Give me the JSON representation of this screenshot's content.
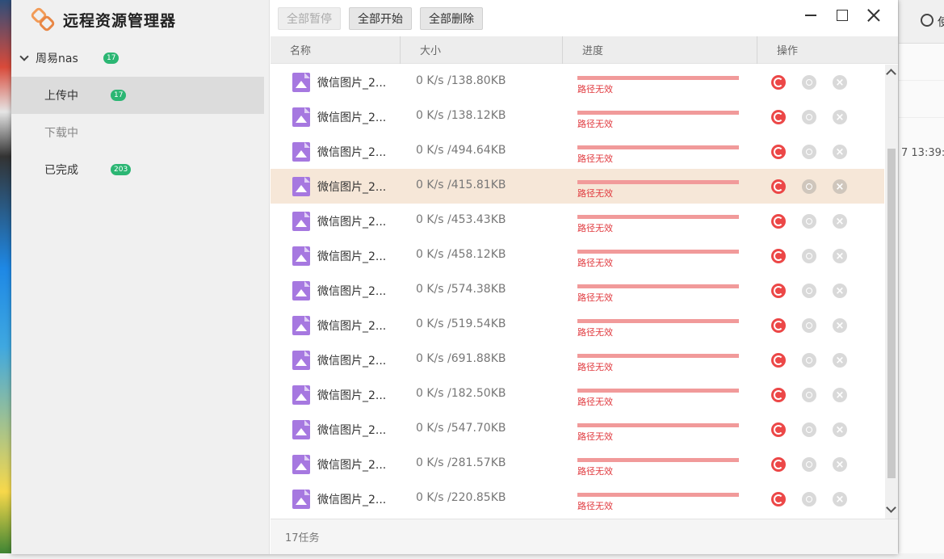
{
  "app": {
    "title": "远程资源管理器"
  },
  "sidebar": {
    "group": {
      "label": "周易nas",
      "count": "17"
    },
    "items": [
      {
        "label": "上传中",
        "count": "17"
      },
      {
        "label": "下载中",
        "count": ""
      },
      {
        "label": "已完成",
        "count": "203"
      }
    ]
  },
  "toolbar": {
    "pause_all": "全部暂停",
    "start_all": "全部开始",
    "delete_all": "全部删除"
  },
  "table": {
    "columns": [
      "名称",
      "大小",
      "进度",
      "操作"
    ],
    "rows": [
      {
        "name": "微信图片_2...",
        "size": "0 K/s /138.80KB",
        "progress": 1.0,
        "status": "路径无效"
      },
      {
        "name": "微信图片_2...",
        "size": "0 K/s /138.12KB",
        "progress": 1.0,
        "status": "路径无效"
      },
      {
        "name": "微信图片_2...",
        "size": "0 K/s /494.64KB",
        "progress": 1.0,
        "status": "路径无效"
      },
      {
        "name": "微信图片_2...",
        "size": "0 K/s /415.81KB",
        "progress": 1.0,
        "status": "路径无效"
      },
      {
        "name": "微信图片_2...",
        "size": "0 K/s /453.43KB",
        "progress": 1.0,
        "status": "路径无效"
      },
      {
        "name": "微信图片_2...",
        "size": "0 K/s /458.12KB",
        "progress": 1.0,
        "status": "路径无效"
      },
      {
        "name": "微信图片_2...",
        "size": "0 K/s /574.38KB",
        "progress": 1.0,
        "status": "路径无效"
      },
      {
        "name": "微信图片_2...",
        "size": "0 K/s /519.54KB",
        "progress": 1.0,
        "status": "路径无效"
      },
      {
        "name": "微信图片_2...",
        "size": "0 K/s /691.88KB",
        "progress": 1.0,
        "status": "路径无效"
      },
      {
        "name": "微信图片_2...",
        "size": "0 K/s /182.50KB",
        "progress": 1.0,
        "status": "路径无效"
      },
      {
        "name": "微信图片_2...",
        "size": "0 K/s /547.70KB",
        "progress": 1.0,
        "status": "路径无效"
      },
      {
        "name": "微信图片_2...",
        "size": "0 K/s /281.57KB",
        "progress": 1.0,
        "status": "路径无效"
      },
      {
        "name": "微信图片_2...",
        "size": "0 K/s /220.85KB",
        "progress": 1.0,
        "status": "路径无效"
      }
    ]
  },
  "footer": {
    "task_count": "17任务"
  },
  "background_window": {
    "label": "使",
    "time": "7 13:39:"
  },
  "colors": {
    "accent_badge": "#2bb673",
    "error": "#e0393e",
    "highlight_row": "#f6e7d8",
    "file_icon": "#a678e0"
  }
}
